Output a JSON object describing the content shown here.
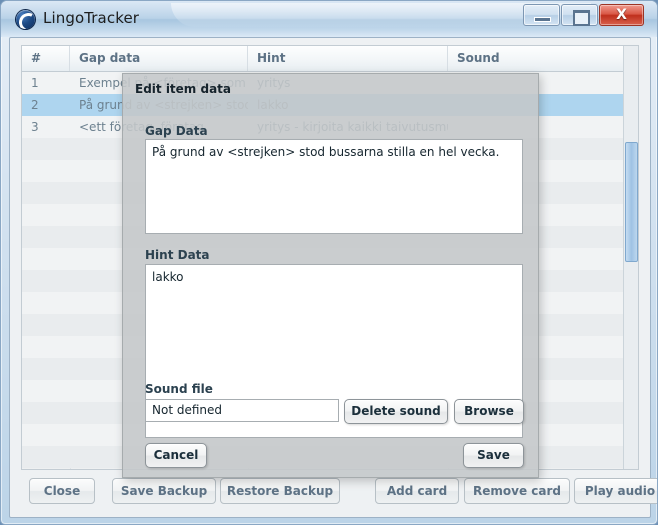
{
  "window": {
    "title": "LingoTracker",
    "icon": "app-globe-icon",
    "controls": {
      "minimize": "minimize-icon",
      "maximize": "maximize-icon",
      "close": "X"
    }
  },
  "table": {
    "columns": [
      "#",
      "Gap data",
      "Hint",
      "Sound"
    ],
    "rows": [
      {
        "index": "1",
        "gap": "Exempel på <företag> som till",
        "hint": "yritys",
        "sound": ""
      },
      {
        "index": "2",
        "gap": "På grund av <strejken> stod b",
        "hint": "lakko",
        "sound": ""
      },
      {
        "index": "3",
        "gap": "<ett företag, företag",
        "hint": "yritys - kirjoita kaikki taivutusmuo",
        "sound": ""
      }
    ],
    "selected_row": 1,
    "scrollbar": "vertical-scrollbar"
  },
  "toolbar": {
    "buttons": [
      {
        "label": "Close",
        "name": "close-button"
      },
      {
        "label": "Save Backup",
        "name": "save-backup-button"
      },
      {
        "label": "Restore Backup",
        "name": "restore-backup-button"
      },
      {
        "label": "Add card",
        "name": "add-card-button"
      },
      {
        "label": "Remove card",
        "name": "remove-card-button"
      },
      {
        "label": "Play audio",
        "name": "play-audio-button"
      }
    ]
  },
  "dialog": {
    "title": "Edit item data",
    "gap_label": "Gap Data",
    "gap_value": "På grund av <strejken> stod bussarna stilla en hel vecka.",
    "hint_label": "Hint Data",
    "hint_value": "lakko",
    "sound_label": "Sound file",
    "sound_value": "Not defined",
    "delete_sound_label": "Delete sound",
    "browse_label": "Browse",
    "cancel_label": "Cancel",
    "save_label": "Save"
  },
  "colors": {
    "selection": "#aed5ef",
    "title_accent": "#b9d2e8",
    "close_red": "#bf2f1c",
    "header_text": "#5d7285",
    "dialog_bg": "#c4c7c9"
  }
}
